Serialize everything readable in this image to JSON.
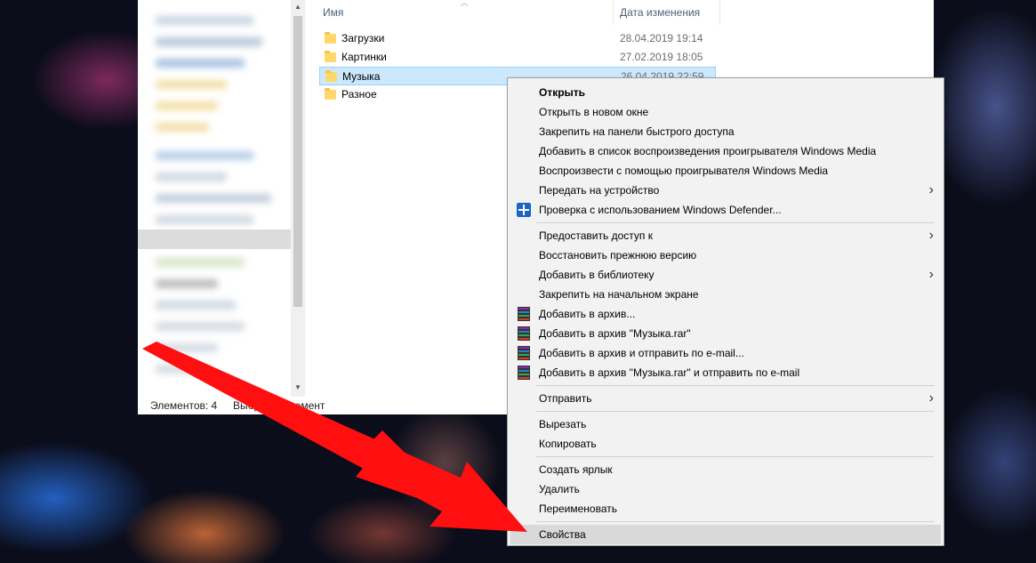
{
  "explorer": {
    "columns": {
      "name": "Имя",
      "date": "Дата изменения"
    },
    "files": [
      {
        "name": "Загрузки",
        "date": "28.04.2019 19:14",
        "selected": false
      },
      {
        "name": "Картинки",
        "date": "27.02.2019 18:05",
        "selected": false
      },
      {
        "name": "Музыка",
        "date": "26.04.2019 22:59",
        "selected": true
      },
      {
        "name": "Разное",
        "date": "",
        "selected": false
      }
    ],
    "status": {
      "count": "Элементов: 4",
      "selection": "Выбран 1 элемент"
    }
  },
  "context_menu": {
    "items": [
      {
        "label": "Открыть",
        "bold": true
      },
      {
        "label": "Открыть в новом окне"
      },
      {
        "label": "Закрепить на панели быстрого доступа"
      },
      {
        "label": "Добавить в список воспроизведения проигрывателя Windows Media"
      },
      {
        "label": "Воспроизвести с помощью проигрывателя Windows Media"
      },
      {
        "label": "Передать на устройство",
        "submenu": true
      },
      {
        "label": "Проверка с использованием Windows Defender...",
        "icon": "windows-defender-icon"
      },
      {
        "label": "Предоставить доступ к",
        "submenu": true
      },
      {
        "label": "Восстановить прежнюю версию"
      },
      {
        "label": "Добавить в библиотеку",
        "submenu": true
      },
      {
        "label": "Закрепить на начальном экране"
      },
      {
        "label": "Добавить в архив...",
        "icon": "winrar-icon"
      },
      {
        "label": "Добавить в архив \"Музыка.rar\"",
        "icon": "winrar-icon"
      },
      {
        "label": "Добавить в архив и отправить по e-mail...",
        "icon": "winrar-icon"
      },
      {
        "label": "Добавить в архив \"Музыка.rar\" и отправить по e-mail",
        "icon": "winrar-icon"
      },
      {
        "label": "Отправить",
        "submenu": true
      },
      {
        "label": "Вырезать"
      },
      {
        "label": "Копировать"
      },
      {
        "label": "Создать ярлык"
      },
      {
        "label": "Удалить"
      },
      {
        "label": "Переименовать"
      },
      {
        "label": "Свойства",
        "highlighted": true
      }
    ],
    "submenu_glyph": "›"
  },
  "colors": {
    "annotation_arrow": "#ff0000",
    "selection": "#cce8ff",
    "menu_bg": "#f2f2f2"
  }
}
